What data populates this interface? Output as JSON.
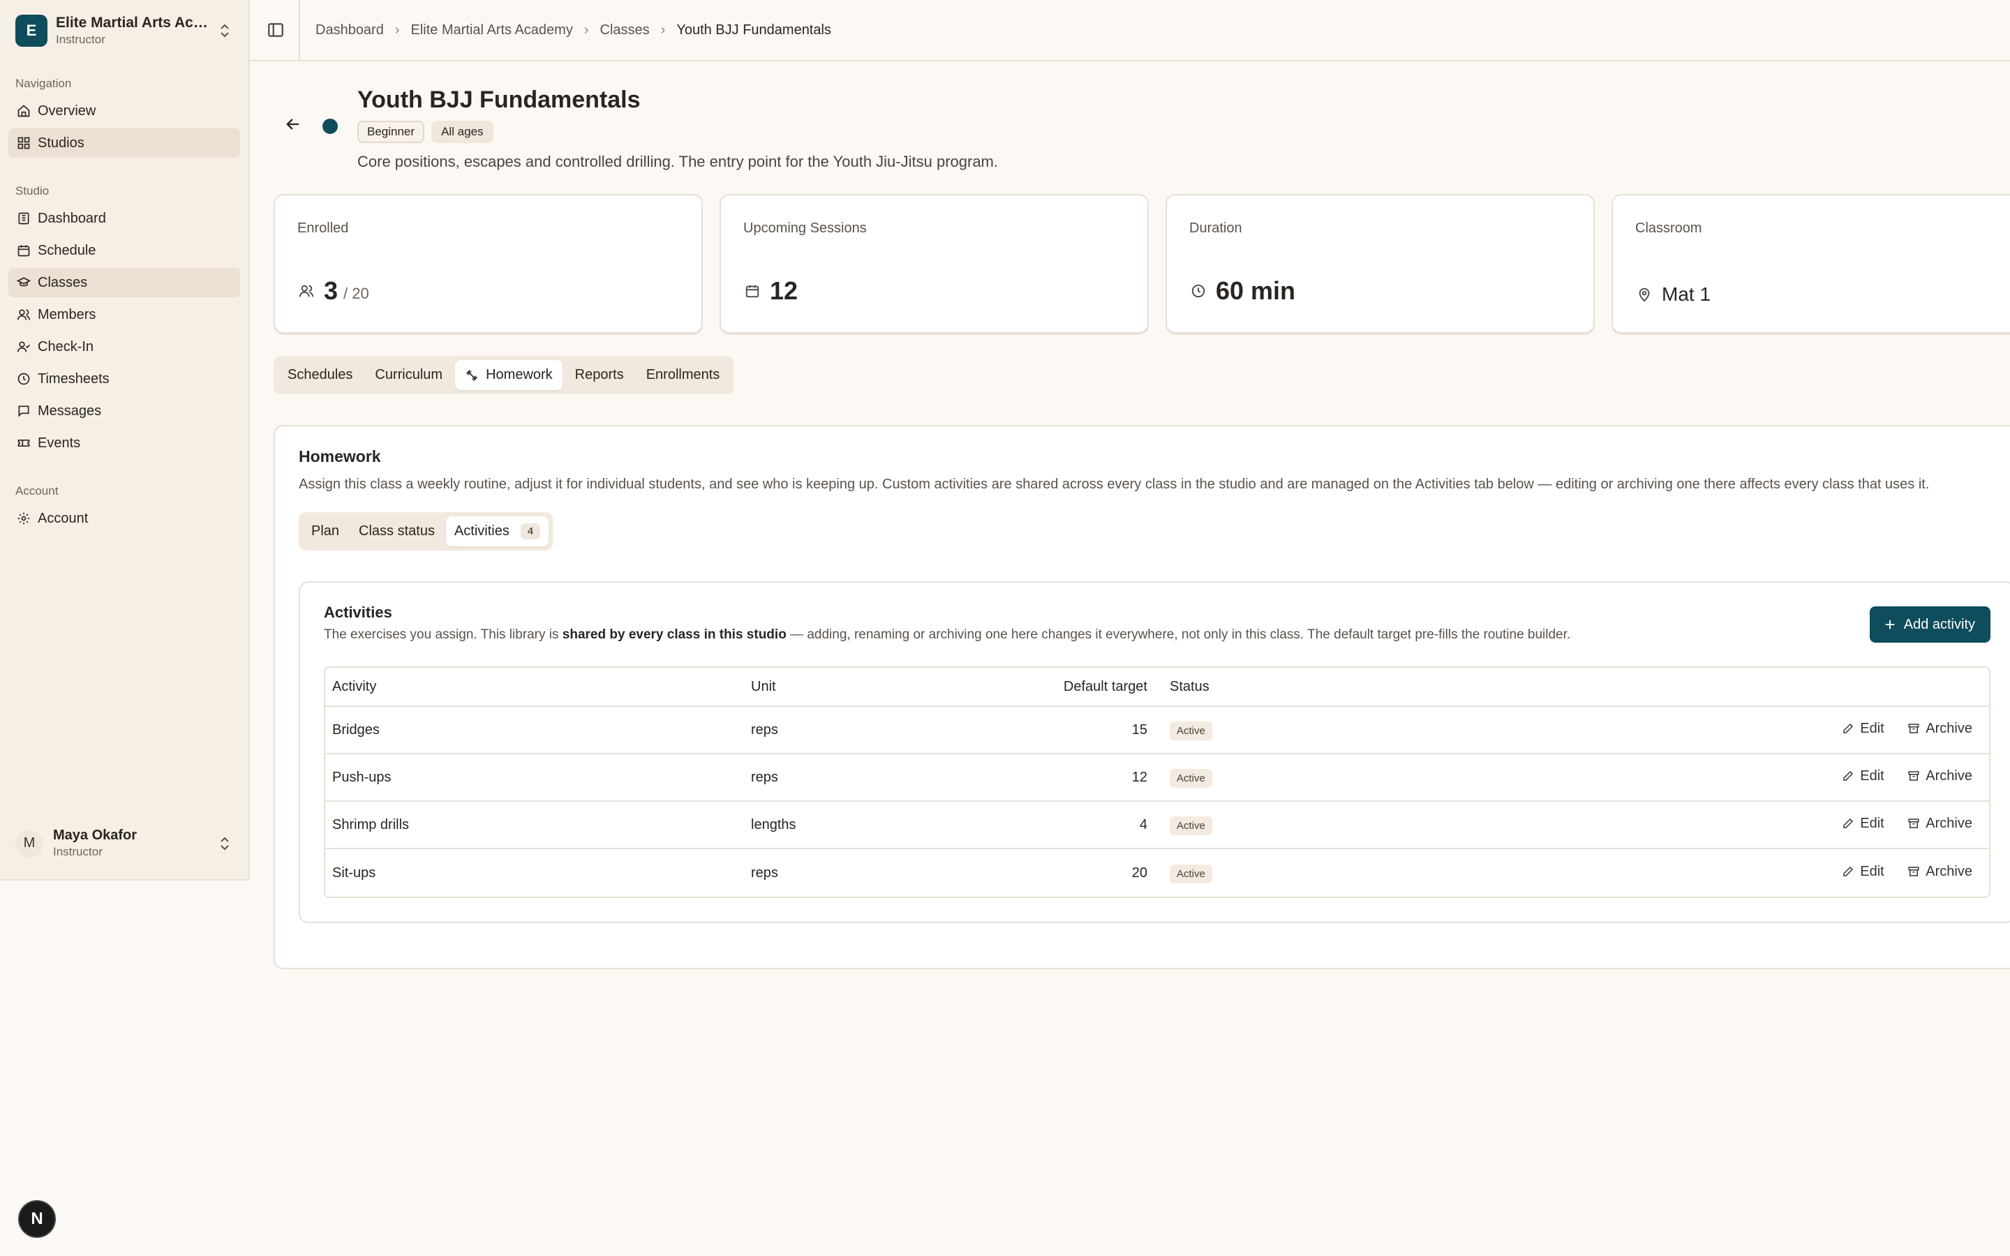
{
  "org": {
    "initial": "E",
    "name": "Elite Martial Arts Academy",
    "role": "Instructor"
  },
  "nav": {
    "section_navigation": "Navigation",
    "overview": "Overview",
    "studios": "Studios",
    "section_studio": "Studio",
    "dashboard": "Dashboard",
    "schedule": "Schedule",
    "classes": "Classes",
    "members": "Members",
    "checkin": "Check-In",
    "timesheets": "Timesheets",
    "messages": "Messages",
    "events": "Events",
    "section_account": "Account",
    "account": "Account"
  },
  "user": {
    "initial": "M",
    "name": "Maya Okafor",
    "role": "Instructor"
  },
  "badge_n": "N",
  "breadcrumbs": [
    "Dashboard",
    "Elite Martial Arts Academy",
    "Classes",
    "Youth BJJ Fundamentals"
  ],
  "class": {
    "title": "Youth BJJ Fundamentals",
    "tags": [
      "Beginner",
      "All ages"
    ],
    "description": "Core positions, escapes and controlled drilling. The entry point for the Youth Jiu-Jitsu program."
  },
  "stats": {
    "enrolled_label": "Enrolled",
    "enrolled_value": "3",
    "enrolled_cap": "/ 20",
    "sessions_label": "Upcoming Sessions",
    "sessions_value": "12",
    "duration_label": "Duration",
    "duration_value": "60 min",
    "classroom_label": "Classroom",
    "classroom_value": "Mat 1"
  },
  "tabs": [
    "Schedules",
    "Curriculum",
    "Homework",
    "Reports",
    "Enrollments"
  ],
  "homework": {
    "title": "Homework",
    "description": "Assign this class a weekly routine, adjust it for individual students, and see who is keeping up. Custom activities are shared across every class in the studio and are managed on the Activities tab below — editing or archiving one there affects every class that uses it.",
    "subtabs": [
      "Plan",
      "Class status",
      "Activities"
    ],
    "activities_count": "4"
  },
  "activities": {
    "title": "Activities",
    "desc_before": "The exercises you assign. This library is ",
    "desc_bold": "shared by every class in this studio",
    "desc_after": " — adding, renaming or archiving one here changes it everywhere, not only in this class. The default target pre-fills the routine builder.",
    "add_label": "Add activity",
    "columns": {
      "activity": "Activity",
      "unit": "Unit",
      "target": "Default target",
      "status": "Status"
    },
    "edit_label": "Edit",
    "archive_label": "Archive",
    "rows": [
      {
        "name": "Bridges",
        "unit": "reps",
        "target": "15",
        "status": "Active"
      },
      {
        "name": "Push-ups",
        "unit": "reps",
        "target": "12",
        "status": "Active"
      },
      {
        "name": "Shrimp drills",
        "unit": "lengths",
        "target": "4",
        "status": "Active"
      },
      {
        "name": "Sit-ups",
        "unit": "reps",
        "target": "20",
        "status": "Active"
      }
    ]
  },
  "colors": {
    "accent": "#0f4c5c",
    "background": "#fcf9f5",
    "sidebar": "#f6efe6"
  }
}
